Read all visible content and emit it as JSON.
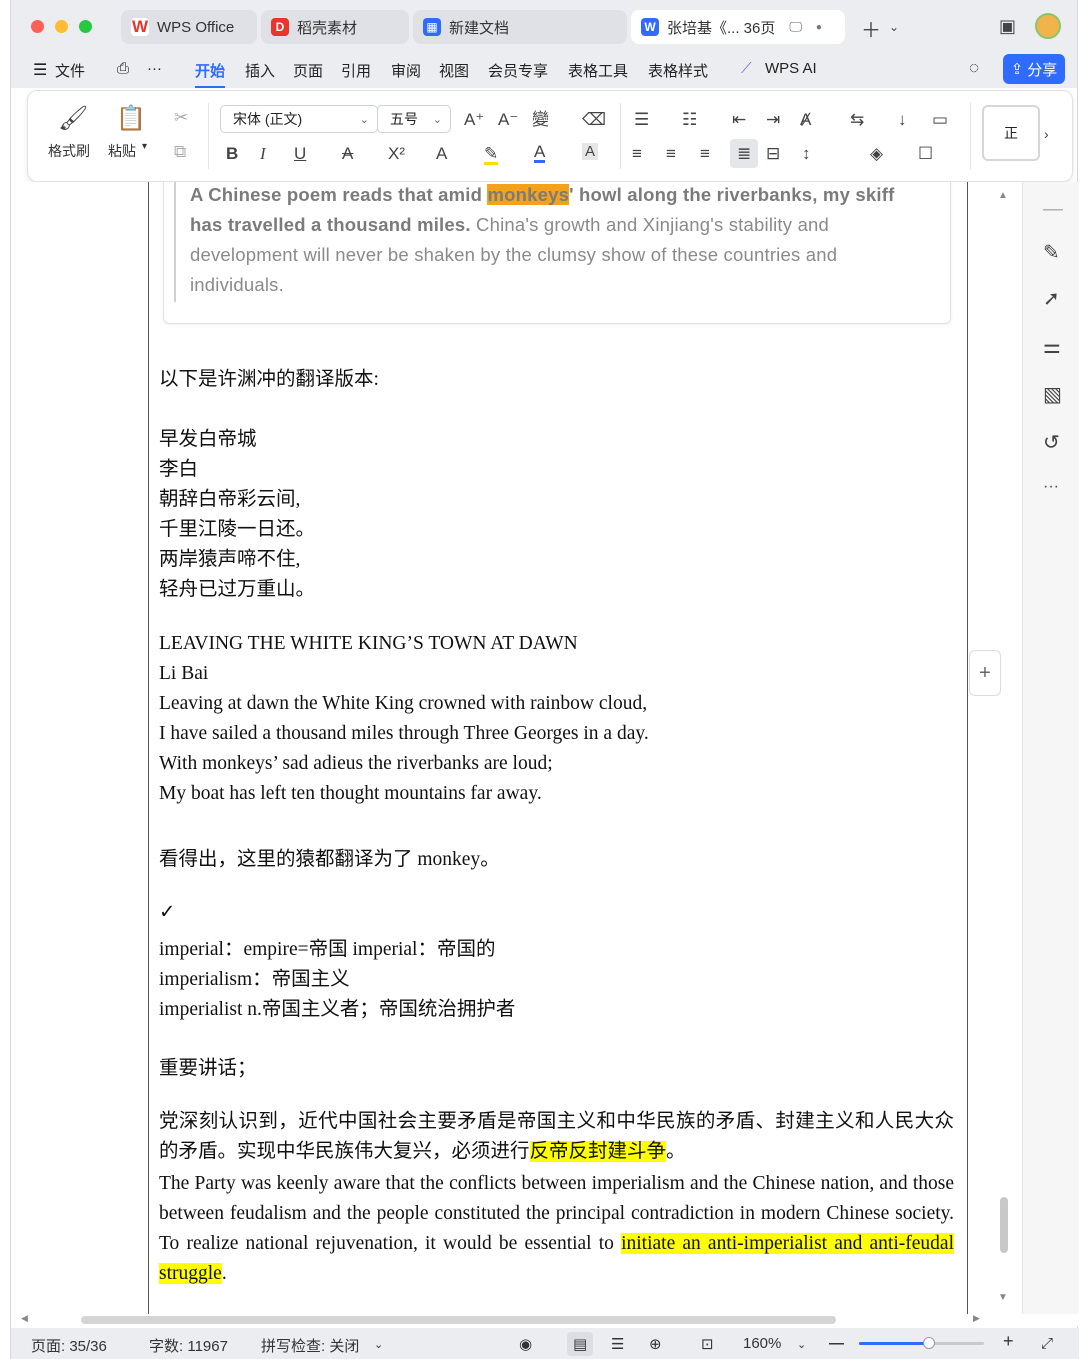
{
  "colors": {
    "accent": "#2f6bff",
    "highlight_yellow": "#ffff00",
    "highlight_orange": "#f4a21c",
    "close": "#fe5f57",
    "minimize": "#febc2e",
    "maximize": "#28c840"
  },
  "tabs": [
    {
      "label": "WPS Office",
      "icon": "wps-logo-icon"
    },
    {
      "label": "稻壳素材",
      "icon": "docer-icon"
    },
    {
      "label": "新建文档",
      "icon": "grid-icon"
    },
    {
      "label": "张培基《... 36页",
      "icon": "word-doc-icon"
    }
  ],
  "menu": {
    "file": "文件",
    "items": [
      "开始",
      "插入",
      "页面",
      "引用",
      "审阅",
      "视图",
      "会员专享",
      "表格工具",
      "表格样式"
    ],
    "ai": "WPS AI",
    "share": "分享"
  },
  "ribbon": {
    "format_painter": "格式刷",
    "paste": "粘贴",
    "font": "宋体 (正文)",
    "size": "五号",
    "style_preview": "正"
  },
  "document": {
    "quote": {
      "bold_prefix": "A Chinese poem reads that amid ",
      "highlight": "monkeys",
      "bold_suffix": "' howl along the riverbanks, my skiff has travelled a thousand miles.",
      "rest": " China's growth and Xinjiang's stability and development will never be shaken by the clumsy show of these countries and individuals."
    },
    "intro": "以下是许渊冲的翻译版本:",
    "poem_cn": [
      "早发白帝城",
      "李白",
      "朝辞白帝彩云间,",
      "千里江陵一日还。",
      "两岸猿声啼不住,",
      "轻舟已过万重山。"
    ],
    "poem_en": [
      "LEAVING THE WHITE KING’S TOWN AT DAWN",
      "Li Bai",
      "Leaving at dawn the White King crowned with rainbow cloud,",
      "I have sailed a thousand miles through Three Georges in a day.",
      "With monkeys’ sad adieus the riverbanks are loud;",
      "My boat has left ten thought mountains far away."
    ],
    "note": "看得出，这里的猿都翻译为了 monkey。",
    "check": "✓",
    "vocab": [
      "imperial：empire=帝国 imperial：帝国的",
      "imperialism：帝国主义",
      "imperialist n.帝国主义者；帝国统治拥护者"
    ],
    "speech_heading": "重要讲话；",
    "para_cn_before": "党深刻认识到，近代中国社会主要矛盾是帝国主义和中华民族的矛盾、封建主义和人民大众的矛盾。实现中华民族伟大复兴，必须进行",
    "para_cn_highlight": "反帝反封建斗争",
    "para_cn_after": "。",
    "para_en_before": "The Party was keenly aware that the conflicts between imperialism and the Chinese nation, and those between feudalism and the people constituted the principal contradiction in modern Chinese society. To realize national rejuvenation, it would be essential to ",
    "para_en_highlight": "initiate an anti-imperialist and anti-feudal struggle",
    "para_en_after": "."
  },
  "status": {
    "page": "页面: 35/36",
    "words": "字数: 11967",
    "spell": "拼写检查: 关闭",
    "zoom": "160%",
    "zoom_slider_fraction": 0.56
  }
}
